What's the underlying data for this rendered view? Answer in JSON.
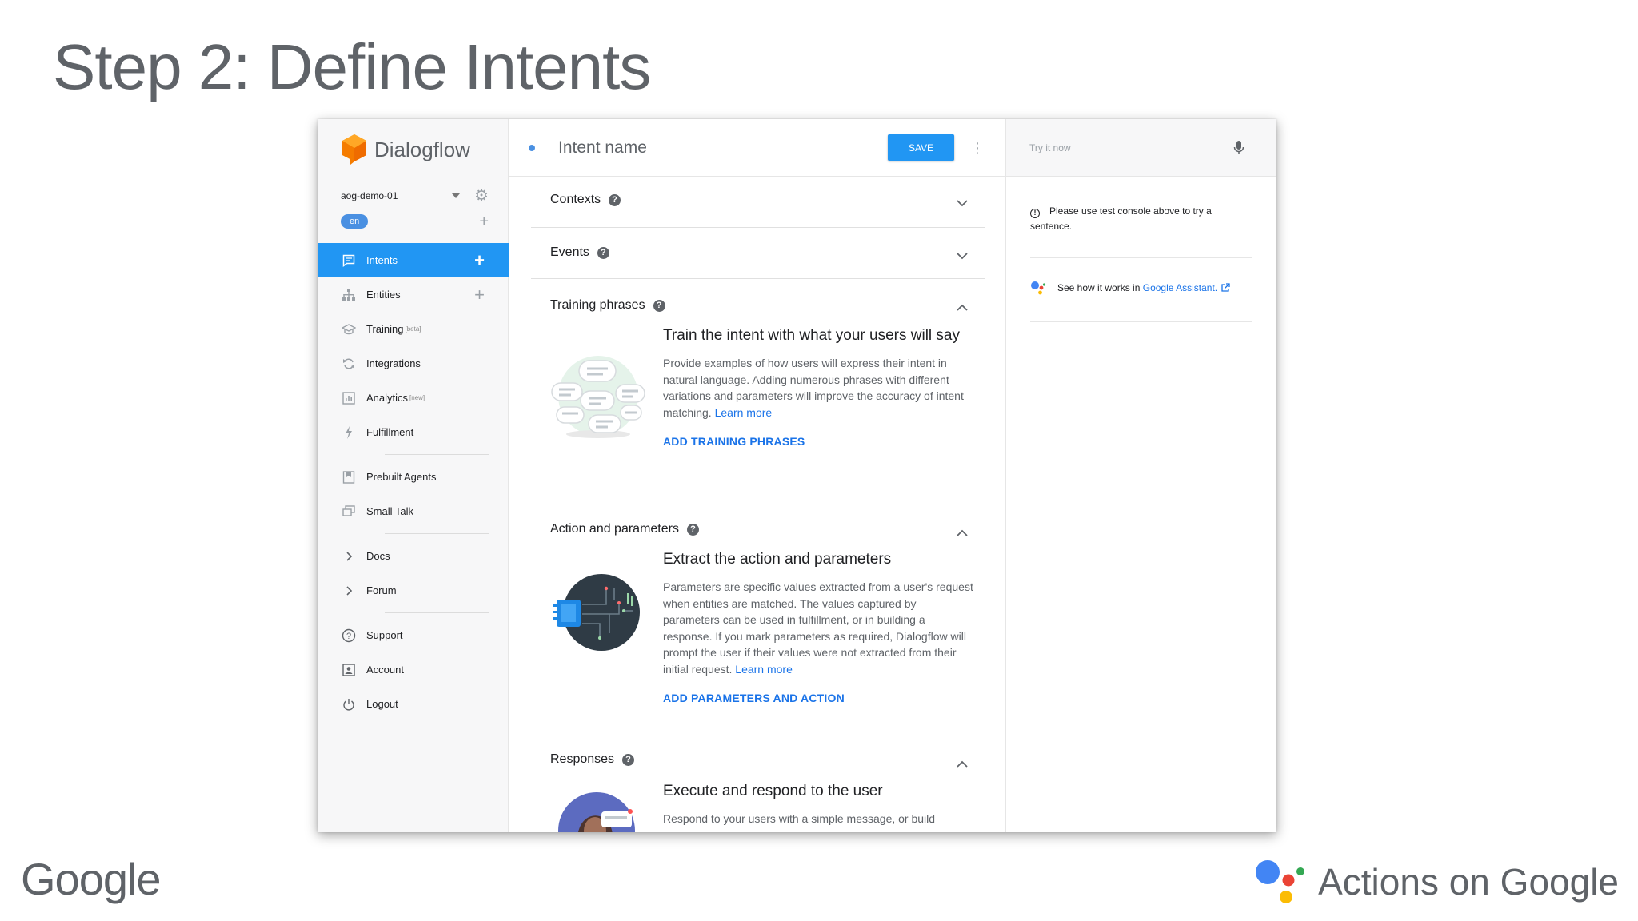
{
  "slide": {
    "title": "Step 2: Define Intents",
    "footer_left": "Google",
    "footer_right": "Actions on Google"
  },
  "sidebar": {
    "brand": "Dialogflow",
    "agent": "aog-demo-01",
    "language": "en",
    "items": [
      {
        "label": "Intents",
        "icon": "chat-icon",
        "active": true
      },
      {
        "label": "Entities",
        "icon": "hierarchy-icon"
      },
      {
        "label": "Training",
        "sup": "[beta]",
        "icon": "graduation-cap-icon"
      },
      {
        "label": "Integrations",
        "icon": "sync-icon"
      },
      {
        "label": "Analytics",
        "sup": "[new]",
        "icon": "bar-chart-icon"
      },
      {
        "label": "Fulfillment",
        "icon": "bolt-icon"
      },
      {
        "label": "Prebuilt Agents",
        "icon": "bookmark-icon"
      },
      {
        "label": "Small Talk",
        "icon": "chat-bubbles-icon"
      },
      {
        "label": "Docs",
        "icon": "chevron-right-icon"
      },
      {
        "label": "Forum",
        "icon": "chevron-right-icon"
      },
      {
        "label": "Support",
        "icon": "help-circle-icon"
      },
      {
        "label": "Account",
        "icon": "account-box-icon"
      },
      {
        "label": "Logout",
        "icon": "power-icon"
      }
    ]
  },
  "main": {
    "intent_placeholder": "Intent name",
    "save_label": "SAVE",
    "sections": {
      "contexts": {
        "title": "Contexts"
      },
      "events": {
        "title": "Events"
      },
      "training": {
        "title": "Training phrases",
        "body_title": "Train the intent with what your users will say",
        "body_text": "Provide examples of how users will express their intent in natural language. Adding numerous phrases with different variations and parameters will improve the accuracy of intent matching.",
        "learn_more": "Learn more",
        "action": "ADD TRAINING PHRASES"
      },
      "action_params": {
        "title": "Action and parameters",
        "body_title": "Extract the action and parameters",
        "body_text": "Parameters are specific values extracted from a user's request when entities are matched. The values captured by parameters can be used in fulfillment, or in building a response. If you mark parameters as required, Dialogflow will prompt the user if their values were not extracted from their initial request.",
        "learn_more": "Learn more",
        "action": "ADD PARAMETERS AND ACTION"
      },
      "responses": {
        "title": "Responses",
        "body_title": "Execute and respond to the user",
        "body_text": "Respond to your users with a simple message, or build"
      }
    }
  },
  "right_panel": {
    "try_placeholder": "Try it now",
    "info_text": "Please use test console above to try a sentence.",
    "ga_prefix": "See how it works in",
    "ga_link": "Google Assistant."
  },
  "colors": {
    "accent": "#2196f3",
    "link": "#1a73e8",
    "logo_orange": "#f57c00"
  }
}
